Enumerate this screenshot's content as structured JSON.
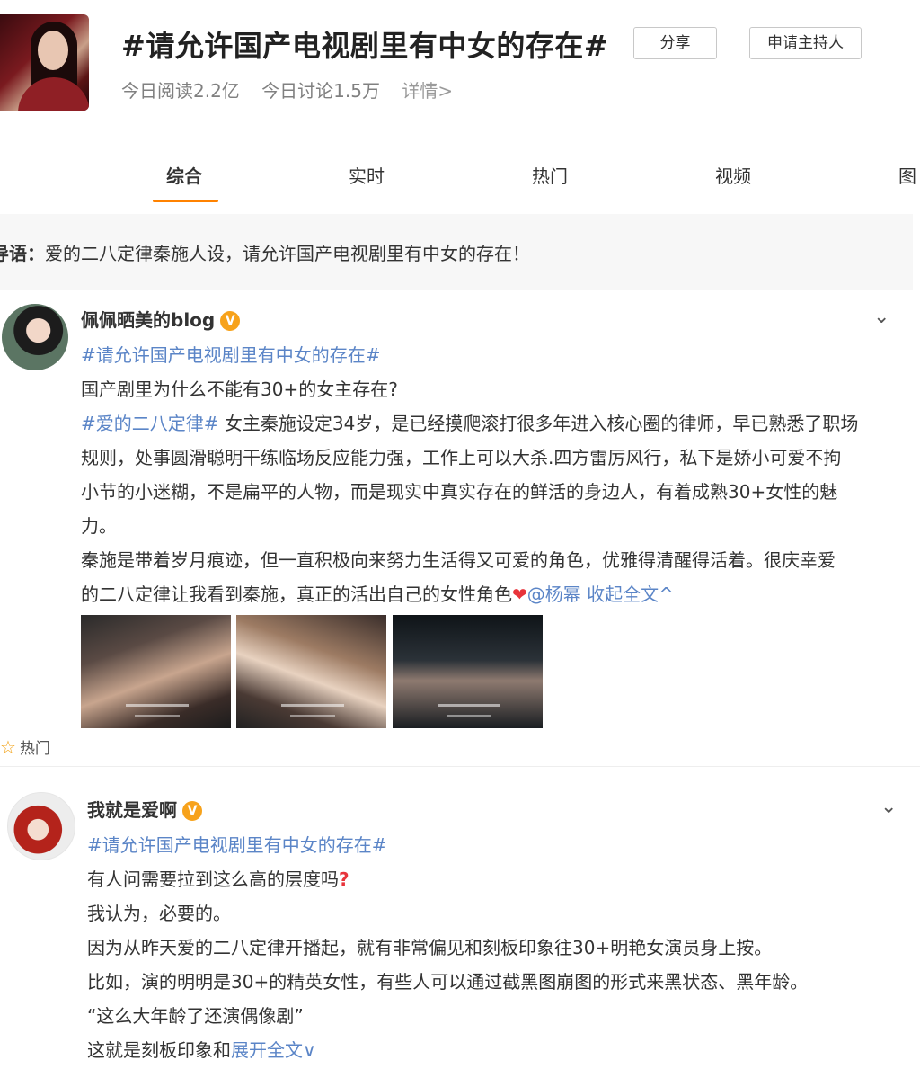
{
  "topic": {
    "title": "#请允许国产电视剧里有中女的存在#",
    "reads": "今日阅读2.2亿",
    "discussions": "今日讨论1.5万",
    "detail": "详情>",
    "share_label": "分享",
    "host_label": "申请主持人"
  },
  "tabs": [
    "综合",
    "实时",
    "热门",
    "视频",
    "图"
  ],
  "lead": {
    "label": "导语：",
    "text": "爱的二八定律秦施人设，请允许国产电视剧里有中女的存在！"
  },
  "post1": {
    "username": "佩佩晒美的blog",
    "badge": "V",
    "topic_tag": "#请允许国产电视剧里有中女的存在#",
    "line1": "国产剧里为什么不能有30+的女主存在?",
    "tag2": "#爱的二八定律#",
    "line2": " 女主秦施设定34岁，是已经摸爬滚打很多年进入核心圈的律师，早已熟悉了职场",
    "line3": "规则，处事圆滑聪明干练临场反应能力强，工作上可以大杀.四方雷厉风行，私下是娇小可爱不拘",
    "line4": "小节的小迷糊，不是扁平的人物，而是现实中真实存在的鲜活的身边人，有着成熟30+女性的魅",
    "line5": "力。",
    "line6": "秦施是带着岁月痕迹，但一直积极向来努力生活得又可爱的角色，优雅得清醒得活着。很庆幸爱",
    "line7": "的二八定律让我看到秦施，真正的活出自己的女性角色",
    "heart": "❤",
    "mention": "@杨幂",
    "collapse": "收起全文^",
    "hot_label": "热门"
  },
  "post2": {
    "username": "我就是爱啊",
    "badge": "V",
    "topic_tag": "#请允许国产电视剧里有中女的存在#",
    "line1": "有人问需要拉到这么高的层度吗",
    "qmark": "?",
    "line2": "我认为，必要的。",
    "line3": "因为从昨天爱的二八定律开播起，就有非常偏见和刻板印象往30+明艳女演员身上按。",
    "line4": "比如，演的明明是30+的精英女性，有些人可以通过截黑图崩图的形式来黑状态、黑年龄。",
    "line5": "“这么大年龄了还演偶像剧”",
    "line6": "这就是刻板印象和",
    "expand": "展开全文∨"
  },
  "icons": {
    "more": "chevron-down-icon",
    "hot": "star-outline-icon"
  },
  "colors": {
    "accent": "#ff8200",
    "link": "#5b85c7",
    "badge": "#f7a21b"
  }
}
